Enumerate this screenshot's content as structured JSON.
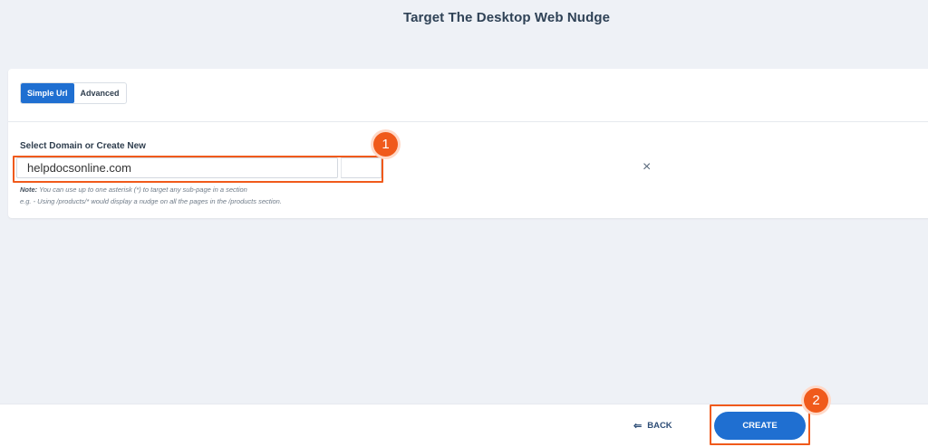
{
  "page": {
    "title": "Target The Desktop Web Nudge"
  },
  "tabs": [
    {
      "label": "Simple Url",
      "active": true
    },
    {
      "label": "Advanced",
      "active": false
    }
  ],
  "domain_field": {
    "label": "Select Domain or Create New",
    "value": "helpdocsonline.com",
    "clear_icon": "×"
  },
  "notes": {
    "note_prefix": "Note:",
    "note_text": " You can use up to one asterisk (*) to target any sub-page in a section",
    "example_text": "e.g. - Using /products/* would display a nudge on all the pages in the /products section."
  },
  "annotations": {
    "step1": "1",
    "step2": "2"
  },
  "footer": {
    "back_label": "BACK",
    "create_label": "CREATE"
  },
  "colors": {
    "accent": "#1f6fd1",
    "highlight": "#f05a1b",
    "background": "#eef1f6"
  },
  "icons": {
    "clear": "close-icon",
    "back": "back-arrow-icon"
  }
}
